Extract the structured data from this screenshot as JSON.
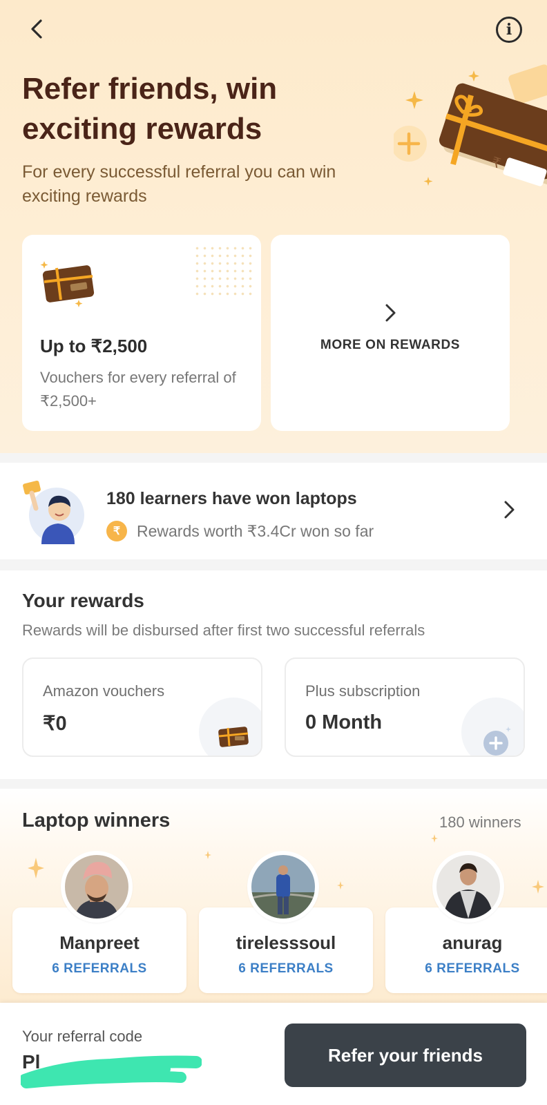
{
  "header": {
    "back_icon": "chevron-left-icon",
    "info_icon": "info-icon",
    "info_glyph": "i"
  },
  "hero": {
    "title": "Refer friends, win exciting rewards",
    "subtitle": "For every successful referral you can win exciting rewards"
  },
  "reward_cards": {
    "voucher": {
      "title": "Up to ₹2,500",
      "description": "Vouchers for every referral of ₹2,500+"
    },
    "more": {
      "label": "MORE ON REWARDS"
    }
  },
  "laptops_banner": {
    "title": "180 learners have won laptops",
    "coin_symbol": "₹",
    "subtitle": "Rewards worth ₹3.4Cr won so far"
  },
  "your_rewards": {
    "title": "Your rewards",
    "subtitle": "Rewards will be disbursed after first two successful referrals",
    "cards": [
      {
        "label": "Amazon vouchers",
        "value": "₹0",
        "icon": "voucher-icon"
      },
      {
        "label": "Plus subscription",
        "value": "0 Month",
        "icon": "plus-badge-icon"
      }
    ]
  },
  "laptop_winners": {
    "title": "Laptop winners",
    "count_label": "180 winners",
    "winners": [
      {
        "name": "Manpreet",
        "referrals": "6 REFERRALS"
      },
      {
        "name": "tirelesssoul",
        "referrals": "6 REFERRALS"
      },
      {
        "name": "anurag",
        "referrals": "6 REFERRALS"
      }
    ]
  },
  "bottom_bar": {
    "code_label": "Your referral code",
    "code_value": "Pl",
    "cta_label": "Refer your friends"
  },
  "colors": {
    "hero_bg": "#fdeacb",
    "title_brown": "#4a2418",
    "accent_orange": "#f7b54a",
    "referral_blue": "#3c7fc6",
    "cta_dark": "#3b4249",
    "redaction_green": "#3ee6b0"
  }
}
